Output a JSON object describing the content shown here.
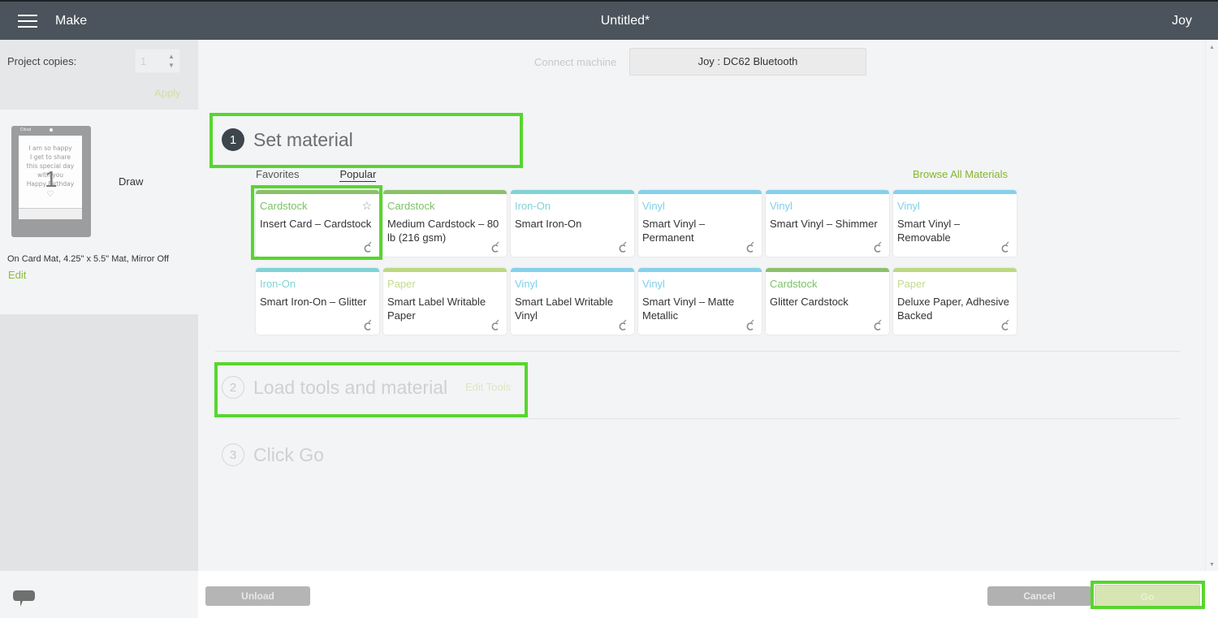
{
  "header": {
    "app_label": "Make",
    "doc_title": "Untitled*",
    "user_name": "Joy"
  },
  "left_panel": {
    "copies_label": "Project copies:",
    "copies_value": "1",
    "apply_label": "Apply",
    "mat": {
      "brand": "Cricut",
      "preview_lines": [
        "I am so happy",
        "I get to share",
        "this special day",
        "with you",
        "Happy Birthday"
      ],
      "heart": "♡",
      "mat_number": "1",
      "action_label": "Draw",
      "info": "On Card Mat, 4.25\" x 5.5\" Mat, Mirror Off",
      "edit_label": "Edit"
    }
  },
  "machine": {
    "connect_label": "Connect machine",
    "connected_machine": "Joy : DC62 Bluetooth"
  },
  "steps": [
    {
      "number": "1",
      "title": "Set material",
      "state": "active"
    },
    {
      "number": "2",
      "title": "Load tools and material",
      "state": "inactive",
      "link": "Edit Tools"
    },
    {
      "number": "3",
      "title": "Click Go",
      "state": "inactive"
    }
  ],
  "material_tabs": [
    {
      "label": "Favorites",
      "selected": false
    },
    {
      "label": "Popular",
      "selected": true
    }
  ],
  "browse_all_label": "Browse All Materials",
  "category_colors": {
    "Cardstock": {
      "bar": "#8cc06c",
      "text": "#7cc265"
    },
    "Iron-On": {
      "bar": "#7fd3d6",
      "text": "#7fd3d6"
    },
    "Vinyl": {
      "bar": "#85d0ea",
      "text": "#80cfe9"
    },
    "Paper": {
      "bar": "#bcd982",
      "text": "#c2dc8c"
    }
  },
  "materials": [
    {
      "category": "Cardstock",
      "name": "Insert Card – Cardstock",
      "selected": true
    },
    {
      "category": "Cardstock",
      "name": "Medium Cardstock – 80 lb (216 gsm)"
    },
    {
      "category": "Iron-On",
      "name": "Smart Iron-On"
    },
    {
      "category": "Vinyl",
      "name": "Smart Vinyl – Permanent"
    },
    {
      "category": "Vinyl",
      "name": "Smart Vinyl – Shimmer"
    },
    {
      "category": "Vinyl",
      "name": "Smart Vinyl – Removable"
    },
    {
      "category": "Iron-On",
      "name": "Smart Iron-On – Glitter"
    },
    {
      "category": "Paper",
      "name": "Smart Label Writable Paper"
    },
    {
      "category": "Vinyl",
      "name": "Smart Label Writable Vinyl"
    },
    {
      "category": "Vinyl",
      "name": "Smart Vinyl – Matte Metallic"
    },
    {
      "category": "Cardstock",
      "name": "Glitter Cardstock"
    },
    {
      "category": "Paper",
      "name": "Deluxe Paper, Adhesive Backed"
    }
  ],
  "footer": {
    "unload_label": "Unload",
    "cancel_label": "Cancel",
    "go_label": "Go"
  },
  "highlight_color": "#57d62d"
}
